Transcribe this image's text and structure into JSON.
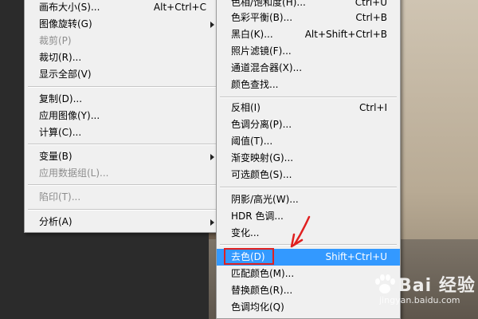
{
  "left_menu": {
    "items": [
      {
        "label": "画布大小(S)...",
        "shortcut": "Alt+Ctrl+C",
        "disabled": false,
        "submenu": false
      },
      {
        "label": "图像旋转(G)",
        "shortcut": "",
        "disabled": false,
        "submenu": true
      },
      {
        "label": "裁剪(P)",
        "shortcut": "",
        "disabled": true,
        "submenu": false
      },
      {
        "label": "裁切(R)...",
        "shortcut": "",
        "disabled": false,
        "submenu": false
      },
      {
        "label": "显示全部(V)",
        "shortcut": "",
        "disabled": false,
        "submenu": false
      },
      {
        "label": "复制(D)...",
        "shortcut": "",
        "disabled": false,
        "submenu": false
      },
      {
        "label": "应用图像(Y)...",
        "shortcut": "",
        "disabled": false,
        "submenu": false
      },
      {
        "label": "计算(C)...",
        "shortcut": "",
        "disabled": false,
        "submenu": false
      },
      {
        "label": "变量(B)",
        "shortcut": "",
        "disabled": false,
        "submenu": true
      },
      {
        "label": "应用数据组(L)...",
        "shortcut": "",
        "disabled": true,
        "submenu": false
      },
      {
        "label": "陷印(T)...",
        "shortcut": "",
        "disabled": true,
        "submenu": false
      },
      {
        "label": "分析(A)",
        "shortcut": "",
        "disabled": false,
        "submenu": true
      }
    ]
  },
  "right_menu": {
    "items": [
      {
        "label": "色相/饱和度(H)...",
        "shortcut": "Ctrl+U",
        "disabled": false
      },
      {
        "label": "色彩平衡(B)...",
        "shortcut": "Ctrl+B",
        "disabled": false
      },
      {
        "label": "黑白(K)...",
        "shortcut": "Alt+Shift+Ctrl+B",
        "disabled": false
      },
      {
        "label": "照片滤镜(F)...",
        "shortcut": "",
        "disabled": false
      },
      {
        "label": "通道混合器(X)...",
        "shortcut": "",
        "disabled": false
      },
      {
        "label": "颜色查找...",
        "shortcut": "",
        "disabled": false
      },
      {
        "label": "反相(I)",
        "shortcut": "Ctrl+I",
        "disabled": false
      },
      {
        "label": "色调分离(P)...",
        "shortcut": "",
        "disabled": false
      },
      {
        "label": "阈值(T)...",
        "shortcut": "",
        "disabled": false
      },
      {
        "label": "渐变映射(G)...",
        "shortcut": "",
        "disabled": false
      },
      {
        "label": "可选颜色(S)...",
        "shortcut": "",
        "disabled": false
      },
      {
        "label": "阴影/高光(W)...",
        "shortcut": "",
        "disabled": false
      },
      {
        "label": "HDR 色调...",
        "shortcut": "",
        "disabled": false
      },
      {
        "label": "变化...",
        "shortcut": "",
        "disabled": false
      },
      {
        "label": "去色(D)",
        "shortcut": "Shift+Ctrl+U",
        "disabled": false,
        "highlighted": true
      },
      {
        "label": "匹配颜色(M)...",
        "shortcut": "",
        "disabled": false
      },
      {
        "label": "替换颜色(R)...",
        "shortcut": "",
        "disabled": false
      },
      {
        "label": "色调均化(Q)",
        "shortcut": "",
        "disabled": false
      }
    ]
  },
  "watermark": {
    "brand": "Bai 经验",
    "url": "jingyan.baidu.com"
  },
  "colors": {
    "highlight": "#3399ff",
    "annotation": "#e02020",
    "menu_bg": "#f0f0f0"
  }
}
